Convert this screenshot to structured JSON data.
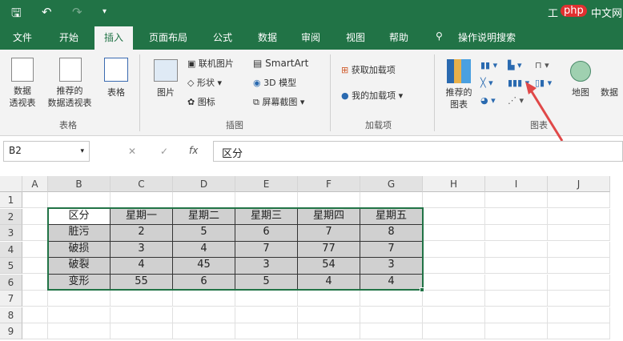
{
  "titlebar": {
    "save": "🖫",
    "undo": "↶",
    "redo": "↷",
    "more": "▾",
    "title": "工",
    "watermark": "php中文网"
  },
  "tabs": [
    "文件",
    "开始",
    "插入",
    "页面布局",
    "公式",
    "数据",
    "审阅",
    "视图",
    "帮助"
  ],
  "tell_me": "操作说明搜索",
  "ribbon": {
    "pivot": "数据\n透视表",
    "rec_pivot": "推荐的\n数据透视表",
    "table": "表格",
    "group_tables": "表格",
    "picture": "图片",
    "online_pic": "联机图片",
    "shapes": "形状",
    "icons": "图标",
    "smartart": "SmartArt",
    "model3d": "3D 模型",
    "screenshot": "屏幕截图",
    "group_illus": "插图",
    "get_addins": "获取加载项",
    "my_addins": "我的加载项",
    "group_addins": "加载项",
    "rec_charts": "推荐的\n图表",
    "maps": "地图",
    "pivotchart": "数据",
    "group_charts": "图表"
  },
  "formula": {
    "namebox": "B2",
    "cancel": "✕",
    "enter": "✓",
    "fx": "fx",
    "value": "区分"
  },
  "columns": [
    "A",
    "B",
    "C",
    "D",
    "E",
    "F",
    "G",
    "H",
    "I",
    "J"
  ],
  "rows": [
    "1",
    "2",
    "3",
    "4",
    "5",
    "6",
    "7",
    "8",
    "9"
  ],
  "table": [
    [
      "区分",
      "星期一",
      "星期二",
      "星期三",
      "星期四",
      "星期五"
    ],
    [
      "脏污",
      "2",
      "5",
      "6",
      "7",
      "8"
    ],
    [
      "破损",
      "3",
      "4",
      "7",
      "77",
      "7"
    ],
    [
      "破裂",
      "4",
      "45",
      "3",
      "54",
      "3"
    ],
    [
      "变形",
      "55",
      "6",
      "5",
      "4",
      "4"
    ]
  ],
  "colors": {
    "accent": "#217346",
    "arrow": "#e04848"
  }
}
